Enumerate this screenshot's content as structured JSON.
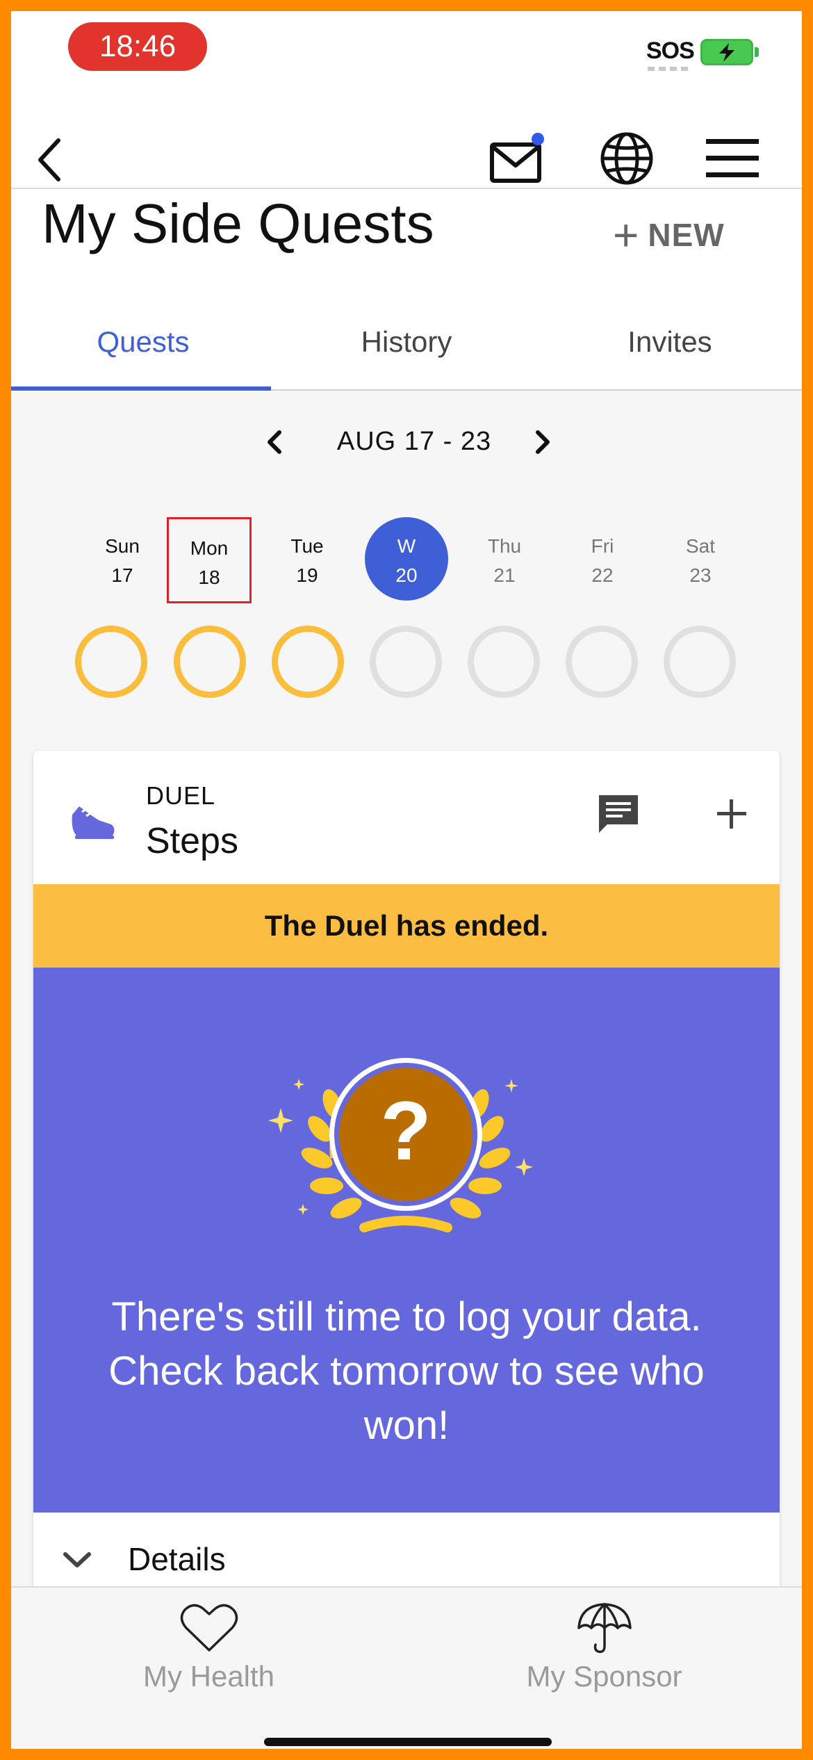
{
  "status_bar": {
    "time": "18:46",
    "sos": "SOS"
  },
  "header": {
    "title": "My Side Quests",
    "new_label": "NEW"
  },
  "tabs": [
    {
      "label": "Quests",
      "active": true
    },
    {
      "label": "History",
      "active": false
    },
    {
      "label": "Invites",
      "active": false
    }
  ],
  "week": {
    "label": "AUG 17 - 23"
  },
  "days": [
    {
      "name": "Sun",
      "date": "17",
      "progress": "partial"
    },
    {
      "name": "Mon",
      "date": "18",
      "progress": "partial"
    },
    {
      "name": "Tue",
      "date": "19",
      "progress": "partial"
    },
    {
      "name": "W",
      "date": "20",
      "progress": "none"
    },
    {
      "name": "Thu",
      "date": "21",
      "progress": "none"
    },
    {
      "name": "Fri",
      "date": "22",
      "progress": "none"
    },
    {
      "name": "Sat",
      "date": "23",
      "progress": "none"
    }
  ],
  "quest": {
    "type": "DUEL",
    "name": "Steps",
    "banner": "The Duel has ended.",
    "trophy_symbol": "?",
    "message": "There's still time to log your data. Check back tomorrow to see who won!",
    "details_label": "Details"
  },
  "bottom_nav": [
    {
      "label": "My Health",
      "icon": "heart-icon"
    },
    {
      "label": "My Sponsor",
      "icon": "umbrella-icon"
    }
  ],
  "colors": {
    "accent": "#3e5fd6",
    "banner": "#fcbe42",
    "card_purple": "#6568dc",
    "ring_done": "#fbbd3c",
    "ring_empty": "#e0e0e0",
    "frame": "#ff8a00"
  }
}
